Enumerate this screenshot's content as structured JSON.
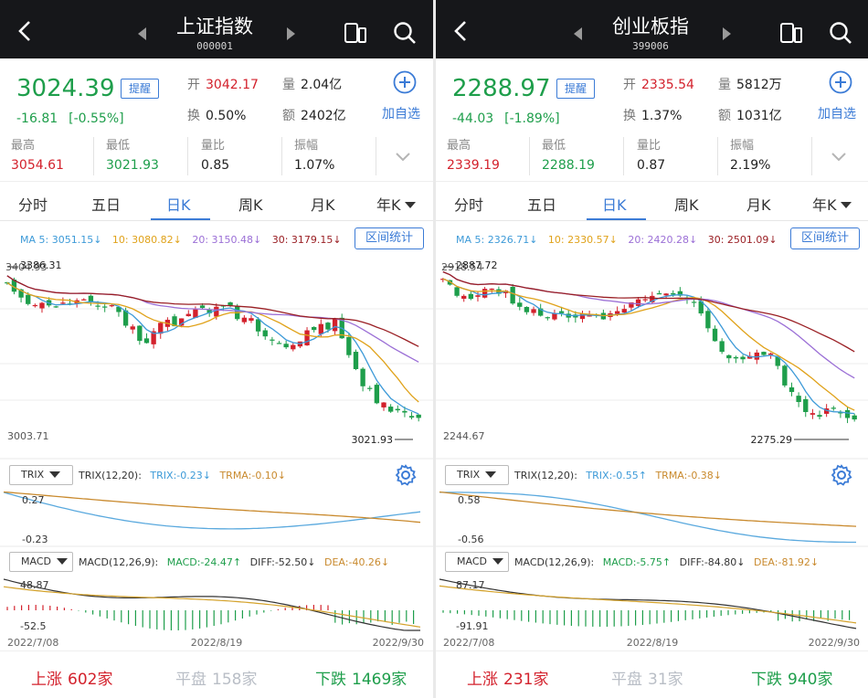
{
  "panels": [
    {
      "title": "上证指数",
      "code": "000001",
      "price": "3024.39",
      "remind": "提醒",
      "change": "-16.81",
      "change_pct": "[-0.55%]",
      "open_k": "开",
      "open_v": "3042.17",
      "volume_k": "量",
      "volume_v": "2.04亿",
      "turnover_k": "换",
      "turnover_v": "0.50%",
      "amount_k": "额",
      "amount_v": "2402亿",
      "add_label": "加自选",
      "stats": [
        {
          "k": "最高",
          "v": "3054.61",
          "color": "red"
        },
        {
          "k": "最低",
          "v": "3021.93",
          "color": "green"
        },
        {
          "k": "量比",
          "v": "0.85",
          "color": "normal"
        },
        {
          "k": "振幅",
          "v": "1.07%",
          "color": "normal"
        }
      ],
      "tabs": [
        "分时",
        "五日",
        "日K",
        "周K",
        "月K",
        "年K"
      ],
      "active_tab": "日K",
      "ma": [
        "MA 5: 3051.15↓",
        "10: 3080.82↓",
        "20: 3150.48↓",
        "30: 3179.15↓"
      ],
      "range_btn": "区间统计",
      "kline_high": "3386.31",
      "kline_top": "3404.93",
      "kline_bottom": "3003.71",
      "kline_low": "3021.93",
      "trix_sel": "TRIX",
      "trix_params": "TRIX(12,20):",
      "trix_val": "TRIX:-0.23↓",
      "trma_val": "TRMA:-0.10↓",
      "trix_top": "0.27",
      "trix_bottom": "-0.23",
      "macd_sel": "MACD",
      "macd_params": "MACD(12,26,9):",
      "macd_val": "MACD:-24.47↑",
      "diff_val": "DIFF:-52.50↓",
      "dea_val": "DEA:-40.26↓",
      "macd_top": "48.87",
      "macd_bottom": "-52.5",
      "date_start": "2022/7/08",
      "date_mid": "2022/8/19",
      "date_end": "2022/9/30",
      "up_k": "上涨",
      "up_v": "602家",
      "flat_k": "平盘",
      "flat_v": "158家",
      "down_k": "下跌",
      "down_v": "1469家"
    },
    {
      "title": "创业板指",
      "code": "399006",
      "price": "2288.97",
      "remind": "提醒",
      "change": "-44.03",
      "change_pct": "[-1.89%]",
      "open_k": "开",
      "open_v": "2335.54",
      "volume_k": "量",
      "volume_v": "5812万",
      "turnover_k": "换",
      "turnover_v": "1.37%",
      "amount_k": "额",
      "amount_v": "1031亿",
      "add_label": "加自选",
      "stats": [
        {
          "k": "最高",
          "v": "2339.19",
          "color": "red"
        },
        {
          "k": "最低",
          "v": "2288.19",
          "color": "green"
        },
        {
          "k": "量比",
          "v": "0.87",
          "color": "normal"
        },
        {
          "k": "振幅",
          "v": "2.19%",
          "color": "normal"
        }
      ],
      "tabs": [
        "分时",
        "五日",
        "日K",
        "周K",
        "月K",
        "年K"
      ],
      "active_tab": "日K",
      "ma": [
        "MA 5: 2326.71↓",
        "10: 2330.57↓",
        "20: 2420.28↓",
        "30: 2501.09↓"
      ],
      "range_btn": "区间统计",
      "kline_high": "2887.72",
      "kline_top": "2918.54",
      "kline_bottom": "2244.67",
      "kline_low": "2275.29",
      "trix_sel": "TRIX",
      "trix_params": "TRIX(12,20):",
      "trix_val": "TRIX:-0.55↑",
      "trma_val": "TRMA:-0.38↓",
      "trix_top": "0.58",
      "trix_bottom": "-0.56",
      "macd_sel": "MACD",
      "macd_params": "MACD(12,26,9):",
      "macd_val": "MACD:-5.75↑",
      "diff_val": "DIFF:-84.80↓",
      "dea_val": "DEA:-81.92↓",
      "macd_top": "87.17",
      "macd_bottom": "-91.91",
      "date_start": "2022/7/08",
      "date_mid": "2022/8/19",
      "date_end": "2022/9/30",
      "up_k": "上涨",
      "up_v": "231家",
      "flat_k": "平盘",
      "flat_v": "31家",
      "down_k": "下跌",
      "down_v": "940家"
    }
  ],
  "colors": {
    "up": "#d3212c",
    "down": "#1e9e4b",
    "accent": "#3b7bd6",
    "ma5": "#3d9ad8",
    "ma10": "#e0a21a",
    "ma20": "#9b6fd6",
    "ma30": "#9a1f24"
  },
  "icons": [
    "back-arrow-icon",
    "prev-triangle-icon",
    "next-triangle-icon",
    "landscape-icon",
    "search-icon",
    "add-circle-icon",
    "chevron-down-icon",
    "gear-icon"
  ],
  "chart_data": [
    {
      "type": "candlestick",
      "title": "上证指数 日K",
      "xlabels": [
        "2022/7/08",
        "2022/8/19",
        "2022/9/30"
      ],
      "ylim": [
        3003.71,
        3404.93
      ],
      "annotations": {
        "high": 3386.31,
        "low": 3021.93
      }
    },
    {
      "type": "candlestick",
      "title": "创业板指 日K",
      "xlabels": [
        "2022/7/08",
        "2022/8/19",
        "2022/9/30"
      ],
      "ylim": [
        2244.67,
        2918.54
      ],
      "annotations": {
        "high": 2887.72,
        "low": 2275.29
      }
    }
  ]
}
